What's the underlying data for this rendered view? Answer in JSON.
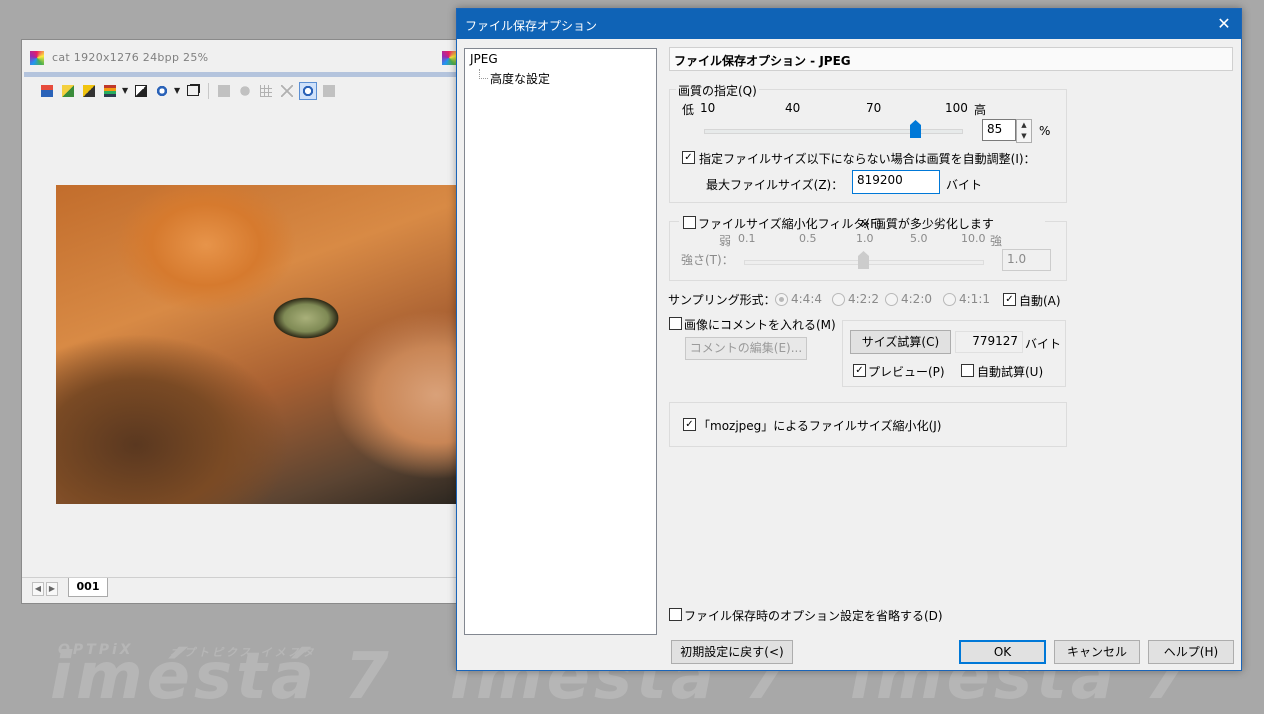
{
  "image_window": {
    "title": "cat  1920x1276  24bpp  25%",
    "tab_label": "001"
  },
  "watermark": {
    "brand_small": "OPTPiX",
    "brand_kana": "オプトピクス イメスタ",
    "brand_big": "iméstá 7"
  },
  "dialog": {
    "title": "ファイル保存オプション",
    "tree": {
      "items": [
        "JPEG",
        "高度な設定"
      ]
    },
    "header": "ファイル保存オプション - JPEG",
    "quality": {
      "group_label": "画質の指定(Q)",
      "low_label": "低",
      "high_label": "高",
      "scale": [
        "10",
        "40",
        "70",
        "100"
      ],
      "value": "85",
      "unit": "%",
      "auto_adjust_label": "指定ファイルサイズ以下にならない場合は画質を自動調整(I)：",
      "auto_adjust_checked": true,
      "max_size_label": "最大ファイルサイズ(Z)：",
      "max_size_value": "819200",
      "max_size_unit": "バイト"
    },
    "filter": {
      "checkbox_label": "ファイルサイズ縮小化フィルタ(F)",
      "note": "※ 画質が多少劣化します",
      "checked": false,
      "weak_label": "弱",
      "strong_label": "強",
      "scale": [
        "0.1",
        "0.5",
        "1.0",
        "5.0",
        "10.0"
      ],
      "strength_label": "強さ(T)：",
      "strength_value": "1.0"
    },
    "sampling": {
      "label": "サンプリング形式：",
      "options": [
        "4:4:4",
        "4:2:2",
        "4:2:0",
        "4:1:1"
      ],
      "selected": "4:4:4",
      "auto_label": "自動(A)",
      "auto_checked": true
    },
    "comment": {
      "checkbox_label": "画像にコメントを入れる(M)",
      "checked": false,
      "edit_button": "コメントの編集(E)..."
    },
    "size_test": {
      "button": "サイズ試算(C)",
      "value": "779127",
      "unit": "バイト",
      "preview_label": "プレビュー(P)",
      "preview_checked": true,
      "auto_label": "自動試算(U)",
      "auto_checked": false
    },
    "mozjpeg": {
      "label": "「mozjpeg」によるファイルサイズ縮小化(J)",
      "checked": true
    },
    "skip_options": {
      "label": "ファイル保存時のオプション設定を省略する(D)",
      "checked": false
    },
    "buttons": {
      "reset": "初期設定に戻す(<)",
      "ok": "OK",
      "cancel": "キャンセル",
      "help": "ヘルプ(H)"
    }
  },
  "colors": {
    "title_bar": "#0f63b6",
    "slider_thumb": "#0078d7",
    "default_button_border": "#0078d7"
  }
}
